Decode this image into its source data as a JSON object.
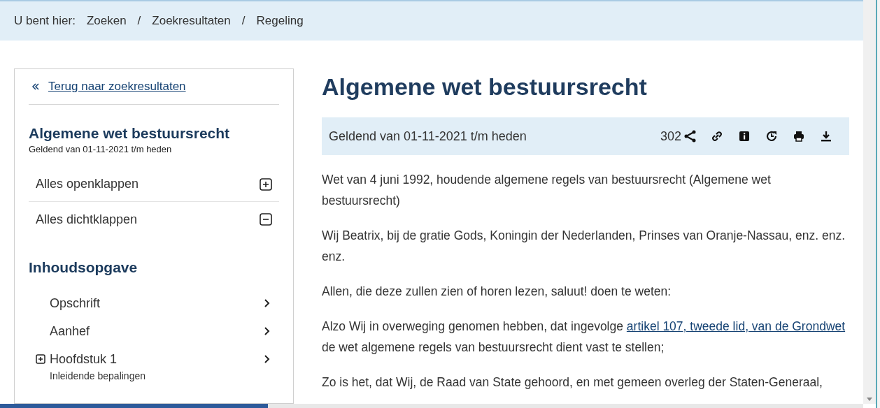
{
  "breadcrumb": {
    "label": "U bent hier:",
    "items": [
      {
        "kind": "link",
        "text": "Zoeken"
      },
      {
        "kind": "separator",
        "text": "/"
      },
      {
        "kind": "link",
        "text": "Zoekresultaten"
      },
      {
        "kind": "separator",
        "text": "/"
      },
      {
        "kind": "current",
        "text": "Regeling"
      }
    ]
  },
  "sidebar": {
    "back_link": "Terug naar zoekresultaten",
    "title": "Algemene wet bestuursrecht",
    "subtitle": "Geldend van 01-11-2021 t/m heden",
    "actions": [
      {
        "label": "Alles openklappen",
        "kind": "expand"
      },
      {
        "label": "Alles dichtklappen",
        "kind": "collapse"
      }
    ],
    "toc_title": "Inhoudsopgave",
    "toc": [
      {
        "label": "Opschrift",
        "expandable": false
      },
      {
        "label": "Aanhef",
        "expandable": false
      },
      {
        "label": "Hoofdstuk 1",
        "expandable": true,
        "subtitle": "Inleidende bepalingen"
      }
    ]
  },
  "document": {
    "title": "Algemene wet bestuursrecht",
    "status": "Geldend van 01-11-2021 t/m heden",
    "count": "302",
    "paragraphs": [
      [
        {
          "text": "Wet van 4 juni 1992, houdende algemene regels van bestuursrecht (Algemene wet bestuursrecht)",
          "link": false
        }
      ],
      [
        {
          "text": "Wij Beatrix, bij de gratie Gods, Koningin der Nederlanden, Prinses van Oranje-Nassau, enz. enz. enz.",
          "link": false
        }
      ],
      [
        {
          "text": "Allen, die deze zullen zien of horen lezen, saluut! doen te weten:",
          "link": false
        }
      ],
      [
        {
          "text": "Alzo Wij in overweging genomen hebben, dat ingevolge ",
          "link": false
        },
        {
          "text": "artikel 107",
          "link": true
        },
        {
          "text": ", tweede lid",
          "link": true
        },
        {
          "text": ", van de Grondwet",
          "link": true
        },
        {
          "text": " de wet algemene regels van bestuursrecht dient vast te stellen;",
          "link": false
        }
      ],
      [
        {
          "text": "Zo is het, dat Wij, de Raad van State gehoord, en met gemeen overleg der Staten-Generaal,",
          "link": false
        }
      ]
    ]
  }
}
